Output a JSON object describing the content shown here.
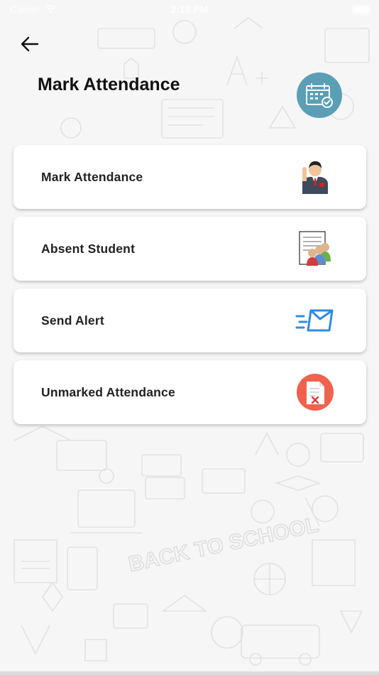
{
  "status_bar": {
    "carrier": "Carrier",
    "time": "2:18 PM"
  },
  "header": {
    "title": "Mark Attendance",
    "back_icon": "arrow-left-icon",
    "badge_icon": "calendar-check-icon",
    "badge_color": "#5b9fb7"
  },
  "menu": {
    "items": [
      {
        "label": "Mark Attendance",
        "icon": "teacher-raising-hand-icon"
      },
      {
        "label": "Absent Student",
        "icon": "student-group-report-icon"
      },
      {
        "label": "Send Alert",
        "icon": "fast-message-icon"
      },
      {
        "label": "Unmarked Attendance",
        "icon": "document-cross-icon"
      }
    ]
  },
  "background": {
    "decor_text": "BACK TO SCHOOL"
  }
}
